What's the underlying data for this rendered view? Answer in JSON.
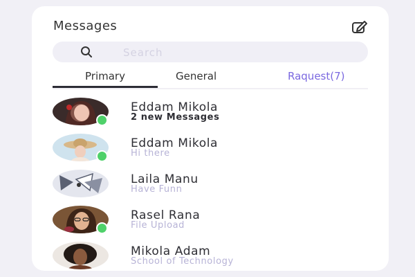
{
  "header": {
    "title": "Messages",
    "compose_icon": "compose-icon"
  },
  "search": {
    "placeholder": "Search"
  },
  "tabs": [
    {
      "label": "Primary",
      "active": true
    },
    {
      "label": "General",
      "active": false
    },
    {
      "label": "Raquest(7)",
      "active": false
    }
  ],
  "conversations": [
    {
      "name": "Eddam Mikola",
      "subtitle": "2 new Messages",
      "unread": true,
      "online": true
    },
    {
      "name": "Eddam Mikola",
      "subtitle": "Hi there",
      "unread": false,
      "online": true
    },
    {
      "name": "Laila Manu",
      "subtitle": "Have Funn",
      "unread": false,
      "online": false
    },
    {
      "name": "Rasel Rana",
      "subtitle": "File Upload",
      "unread": false,
      "online": true
    },
    {
      "name": "Mikola Adam",
      "subtitle": "School of Technology",
      "unread": false,
      "online": false
    }
  ],
  "colors": {
    "accent": "#7a68e0",
    "online": "#4fd16a",
    "muted": "#b7b3d6",
    "background": "#f1f0f6"
  }
}
